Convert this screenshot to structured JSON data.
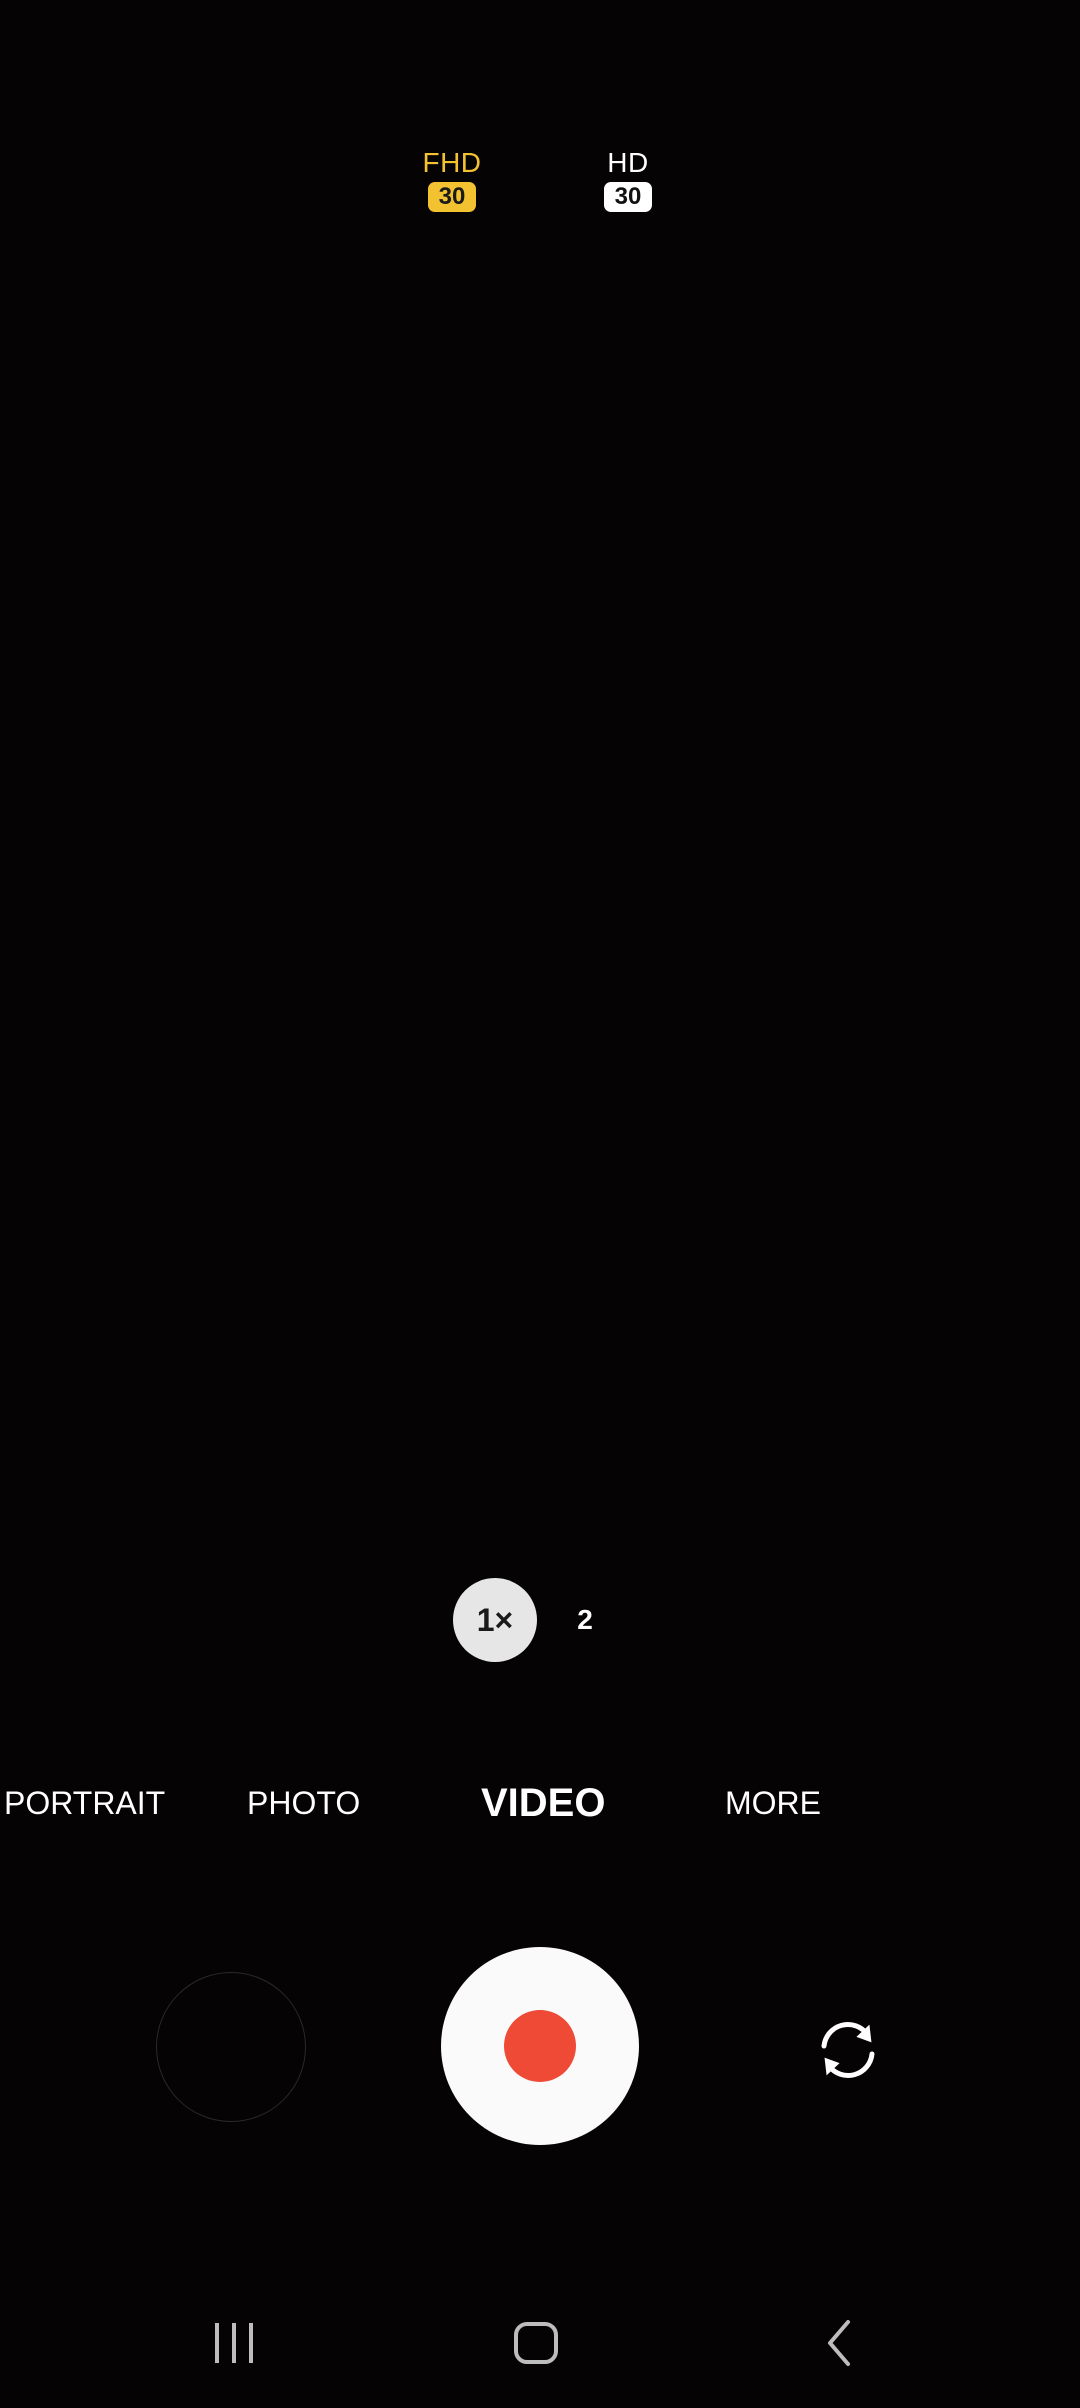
{
  "resolution": {
    "fhd": {
      "label": "FHD",
      "fps": "30",
      "selected": true,
      "color": "#f2c230"
    },
    "hd": {
      "label": "HD",
      "fps": "30",
      "selected": false
    }
  },
  "zoom": {
    "current": "1×",
    "alt": "2"
  },
  "modes": {
    "portrait": "PORTRAIT",
    "photo": "PHOTO",
    "video": "VIDEO",
    "more": "MORE",
    "selected": "VIDEO"
  },
  "controls": {
    "gallery_icon": "gallery-thumbnail",
    "record_icon": "record-icon",
    "record_color": "#ef4a36",
    "switch_icon": "switch-camera-icon"
  },
  "navbar": {
    "recents_icon": "recents-icon",
    "home_icon": "home-icon",
    "back_icon": "back-icon"
  }
}
